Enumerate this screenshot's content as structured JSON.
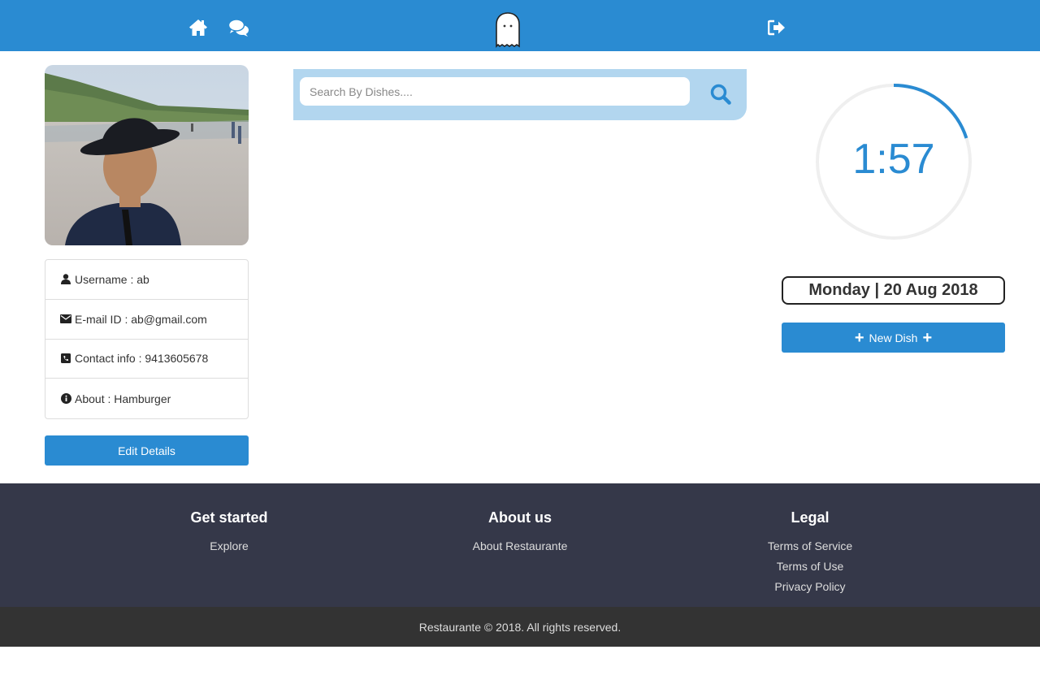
{
  "nav": {
    "home_icon": "home-icon",
    "chat_icon": "comments-icon",
    "logo_icon": "ghost-icon",
    "logout_icon": "sign-out-icon"
  },
  "profile": {
    "photo_alt": "profile-photo",
    "items": [
      {
        "icon": "user-icon",
        "text": "Username : ab"
      },
      {
        "icon": "envelope-icon",
        "text": "E-mail ID : ab@gmail.com"
      },
      {
        "icon": "phone-square-icon",
        "text": "Contact info : 9413605678"
      },
      {
        "icon": "info-circle-icon",
        "text": "About : Hamburger"
      }
    ],
    "edit_label": "Edit Details"
  },
  "search": {
    "placeholder": "Search By Dishes....",
    "value": ""
  },
  "timer": {
    "time": "1:57",
    "progress_fraction": 0.2
  },
  "date": "Monday | 20 Aug 2018",
  "new_dish_label": "New Dish",
  "footer": {
    "columns": [
      {
        "title": "Get started",
        "links": [
          "Explore"
        ]
      },
      {
        "title": "About us",
        "links": [
          "About Restaurante"
        ]
      },
      {
        "title": "Legal",
        "links": [
          "Terms of Service",
          "Terms of Use",
          "Privacy Policy"
        ]
      }
    ],
    "copyright": "Restaurante © 2018. All rights reserved."
  },
  "colors": {
    "primary": "#2a8bd2",
    "search_bg": "#b2d6ef",
    "footer_bg": "#353849",
    "copyright_bg": "#333333"
  }
}
